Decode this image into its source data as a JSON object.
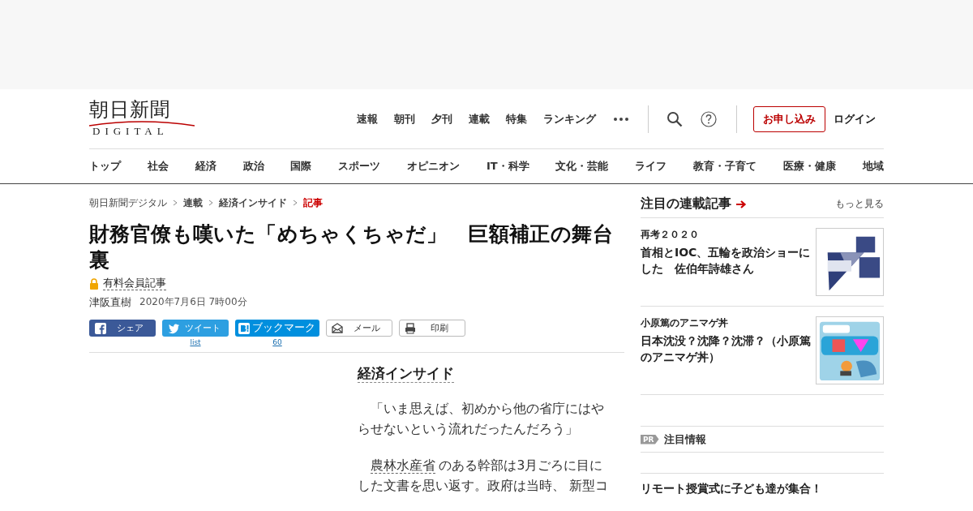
{
  "header": {
    "logo": {
      "title": "朝日新聞",
      "subtitle": "DIGITAL"
    },
    "nav_links": [
      "速報",
      "朝刊",
      "夕刊",
      "連載",
      "特集",
      "ランキング"
    ],
    "subscribe_button": "お申し込み",
    "login_link": "ログイン"
  },
  "categories": [
    "トップ",
    "社会",
    "経済",
    "政治",
    "国際",
    "スポーツ",
    "オピニオン",
    "IT・科学",
    "文化・芸能",
    "ライフ",
    "教育・子育て",
    "医療・健康",
    "地域"
  ],
  "breadcrumbs": [
    {
      "label": "朝日新聞デジタル",
      "current": false,
      "bold": false
    },
    {
      "label": "連載",
      "current": false,
      "bold": true
    },
    {
      "label": "経済インサイド",
      "current": false,
      "bold": true
    },
    {
      "label": "記事",
      "current": true,
      "bold": true
    }
  ],
  "article": {
    "title": "財務官僚も嘆いた「めちゃくちゃだ」　巨額補正の舞台裏",
    "badge": "有料会員記事",
    "author": "津阪直樹",
    "date": "2020年7月6日 7時00分",
    "share_buttons": [
      {
        "kind": "facebook",
        "label": "シェア"
      },
      {
        "kind": "twitter",
        "label": "ツイート",
        "count": "list"
      },
      {
        "kind": "hatena",
        "label": "ブックマーク",
        "count": "60"
      },
      {
        "kind": "mail",
        "label": "メール"
      },
      {
        "kind": "print",
        "label": "印刷"
      }
    ],
    "section_label": "経済インサイド",
    "paragraphs": [
      [
        {
          "text": "「いま思えば、初めから他の省庁にはやらせないという流れだったんだろう」",
          "link": false
        }
      ],
      [
        {
          "text": "農林水産省",
          "link": true
        },
        {
          "text": " のある幹部は3月ごろに目にした文書を思い返す。政府は当時、 新型コ",
          "link": false
        }
      ]
    ]
  },
  "sidebar": {
    "heading": "注目の連載記事",
    "more_link": "もっと見る",
    "items": [
      {
        "series": "再考２０２０",
        "title": "首相とIOC、五輪を政治ショーにした　佐伯年詩雄さん"
      },
      {
        "series": "小原篤のアニマゲ丼",
        "title": "日本沈没？沈降？沈滞？（小原篤のアニマゲ丼）"
      }
    ],
    "pr": {
      "badge": "PR",
      "heading": "注目情報",
      "headline": "リモート授賞式に子ども達が集合！"
    }
  }
}
